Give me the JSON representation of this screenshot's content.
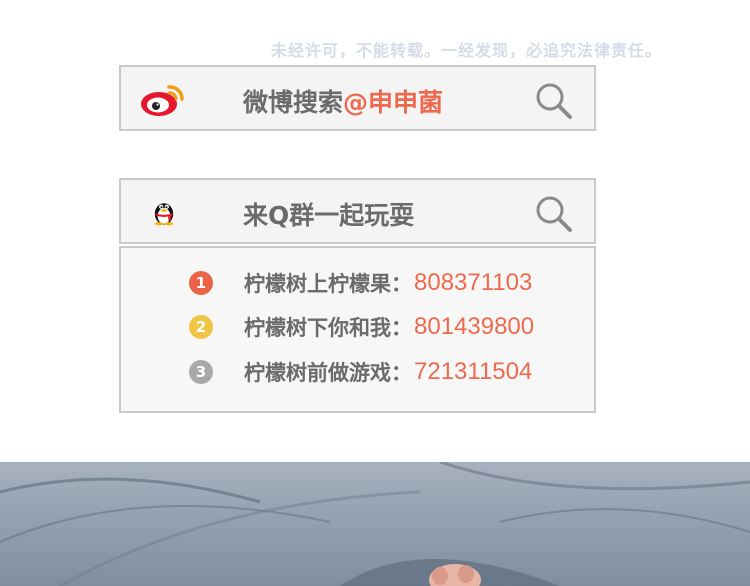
{
  "notice": "未经许可，不能转载。一经发现，必追究法律责任。",
  "weibo_search": {
    "prefix": "微博搜索",
    "handle": "@申申菌",
    "logo_icon": "weibo-logo-icon",
    "search_icon": "magnifier-icon"
  },
  "qq_search": {
    "label": "来Q群一起玩耍",
    "logo_icon": "qq-penguin-icon",
    "search_icon": "magnifier-icon"
  },
  "qq_groups": [
    {
      "badge": "1",
      "badge_color": "#ec6447",
      "label": "柠檬树上柠檬果：",
      "number": "808371103"
    },
    {
      "badge": "2",
      "badge_color": "#f2c443",
      "label": "柠檬树下你和我：",
      "number": "801439800"
    },
    {
      "badge": "3",
      "badge_color": "#a9a9a9",
      "label": "柠檬树前做游戏：",
      "number": "721311504"
    }
  ],
  "colors": {
    "accent": "#ed6a4e",
    "text_gray": "#6b6b6b",
    "border": "#c9c9c9"
  }
}
